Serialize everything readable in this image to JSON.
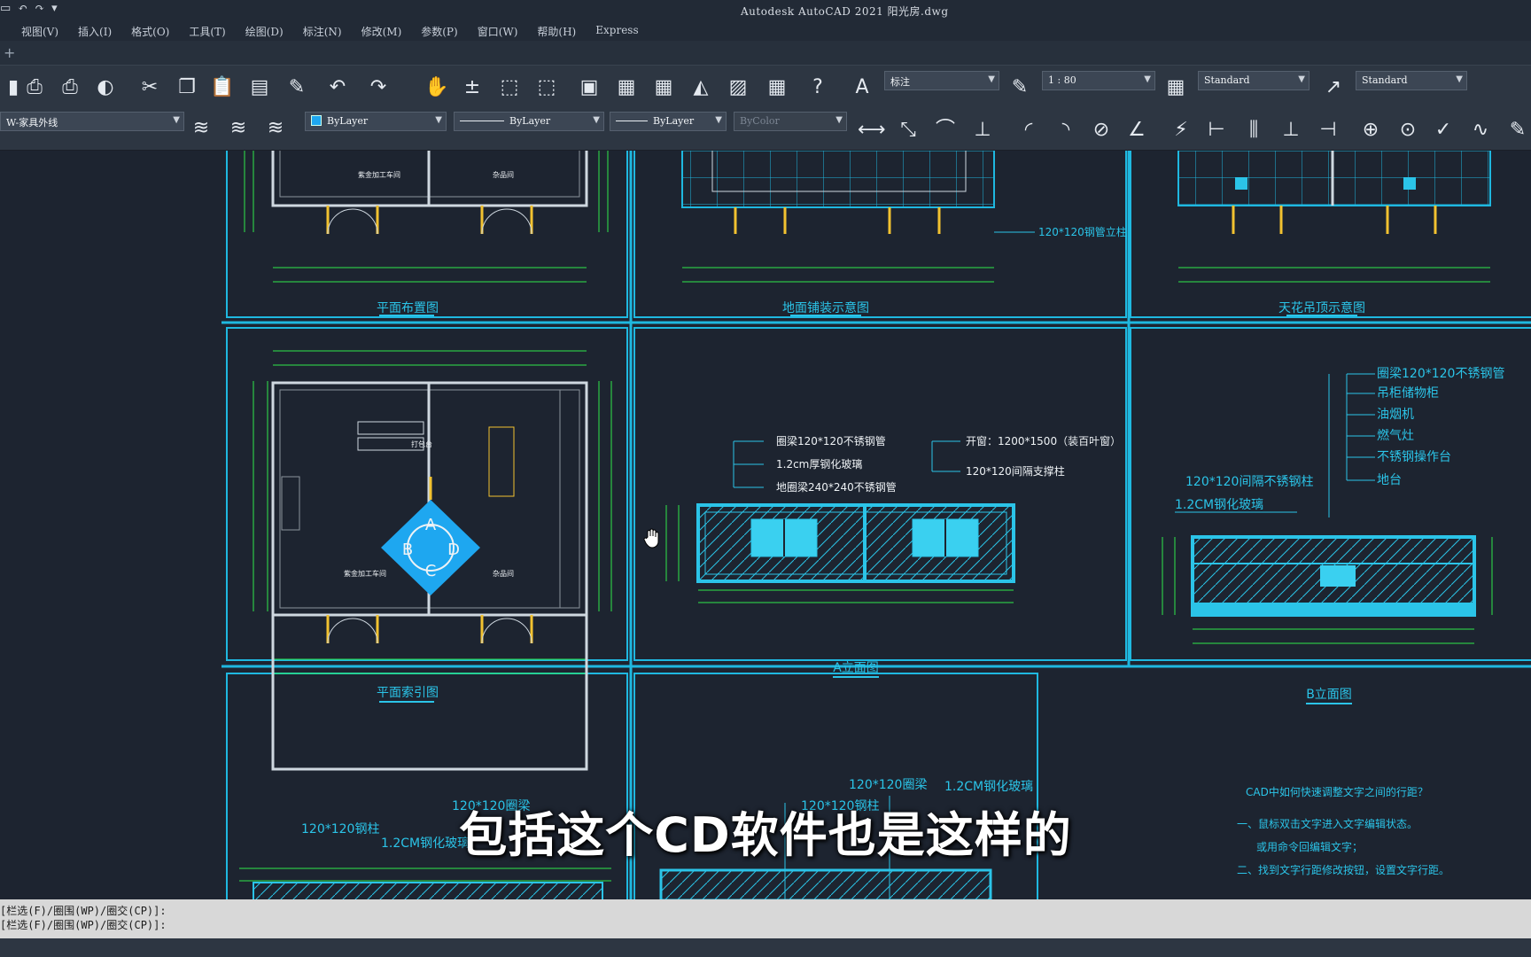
{
  "window": {
    "title": "Autodesk AutoCAD 2021    阳光房.dwg"
  },
  "menu": [
    "视图(V)",
    "插入(I)",
    "格式(O)",
    "工具(T)",
    "绘图(D)",
    "标注(N)",
    "修改(M)",
    "参数(P)",
    "窗口(W)",
    "帮助(H)",
    "Express"
  ],
  "toolbar": {
    "annotation_style": "标注",
    "scale": "1 : 80",
    "table_style": "Standard",
    "multileader_style": "Standard"
  },
  "properties": {
    "layer": "W-家具外线",
    "color": "ByLayer",
    "linetype": "ByLayer",
    "lineweight": "ByLayer",
    "plotstyle": "ByColor"
  },
  "drawing": {
    "panels": {
      "plan_layout": "平面布置图",
      "floor_paving": "地面铺装示意图",
      "ceiling": "天花吊顶示意图",
      "plan_index": "平面索引图",
      "elev_a": "A立面图",
      "elev_b": "B立面图"
    },
    "room_label_1": "紫金加工车间",
    "room_label_2": "杂品间",
    "pipe_note": "120*120钢管立柱",
    "index_letters": [
      "A",
      "B",
      "C",
      "D"
    ],
    "counter_label": "打包台",
    "elev_a_notes": [
      "圈梁120*120不锈钢管",
      "1.2cm厚钢化玻璃",
      "地圈梁240*240不锈钢管",
      "开窗：1200*1500（装百叶窗）",
      "120*120间隔支撑柱"
    ],
    "elev_b_notes": [
      "圈梁120*120不锈钢管",
      "吊柜储物柜",
      "油烟机",
      "燃气灶",
      "不锈钢操作台",
      "地台"
    ],
    "elev_b_left_notes": [
      "120*120间隔不锈钢柱",
      "1.2CM钢化玻璃"
    ],
    "bottom_notes": [
      "120*120钢柱",
      "1.2CM钢化玻璃",
      "120*120圈梁",
      "120*120钢柱",
      "120*120圈梁",
      "1.2CM钢化玻璃"
    ],
    "tip_title": "CAD中如何快速调整文字之间的行距？",
    "tip_lines": [
      "一、鼠标双击文字进入文字编辑状态。",
      "或用命令回编辑文字；",
      "二、找到文字行距修改按钮，设置文字行距。"
    ]
  },
  "command_history": [
    "[栏选(F)/圈围(WP)/圈交(CP)]:",
    "[栏选(F)/圈围(WP)/圈交(CP)]:"
  ],
  "subtitle": "包括这个CD软件也是这样的"
}
